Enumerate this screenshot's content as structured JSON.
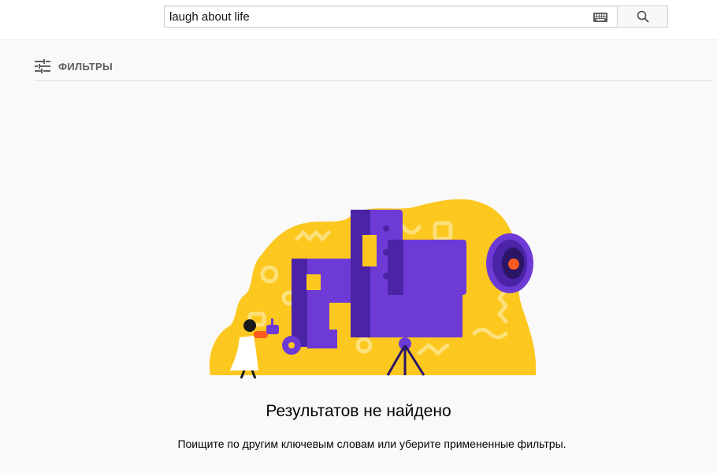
{
  "search": {
    "value": "laugh about life",
    "keyboard_icon": "keyboard-icon",
    "button_icon": "search-icon"
  },
  "filters": {
    "label": "ФИЛЬТРЫ",
    "icon": "filter-sliders-icon"
  },
  "empty_state": {
    "title": "Результатов не найдено",
    "subtitle": "Поищите по другим ключевым словам или уберите примененные фильтры."
  },
  "colors": {
    "accent_yellow": "#fcc81f",
    "accent_purple": "#6e3ad6",
    "accent_orange": "#ff5a1f"
  }
}
